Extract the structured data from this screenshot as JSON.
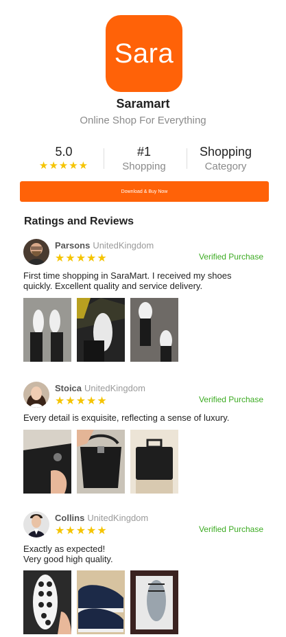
{
  "app": {
    "logo_text": "Sara",
    "name": "Saramart",
    "tagline": "Online Shop For Everything",
    "brand_color": "#ff6208"
  },
  "stats": {
    "rating": {
      "value": "5.0",
      "stars": "★★★★★"
    },
    "rank": {
      "value": "#1",
      "label": "Shopping"
    },
    "category": {
      "value": "Shopping",
      "label": "Category"
    }
  },
  "download_button": {
    "label": "Download & Buy Now"
  },
  "reviews_section": {
    "title": "Ratings and Reviews",
    "reviews": [
      {
        "name": "Parsons",
        "country": "UnitedKingdom",
        "stars": "★★★★★",
        "badge": "Verified Purchase",
        "text": "First time shopping in SaraMart. I received my shoes quickly. Excellent quality and service delivery.",
        "photos": [
          "white-sneakers-on-feet",
          "white-sneaker-car-floor",
          "white-sneakers-on-feet-2"
        ]
      },
      {
        "name": "Stoica",
        "country": "UnitedKingdom",
        "stars": "★★★★★",
        "badge": "Verified Purchase",
        "text": "Every detail is exquisite, reflecting a sense of luxury.",
        "photos": [
          "black-leather-bag-closeup",
          "black-leather-bag-open",
          "black-leather-briefcase"
        ]
      },
      {
        "name": "Collins",
        "country": "UnitedKingdom",
        "stars": "★★★★★",
        "badge": "Verified Purchase",
        "text": "Exactly as expected!\nVery good high quality.",
        "photos": [
          "white-sole-navy-shoe",
          "navy-shoes-pair",
          "shoe-in-box"
        ]
      }
    ]
  },
  "colors": {
    "stars": "#f5c400",
    "verified": "#3cab22"
  }
}
